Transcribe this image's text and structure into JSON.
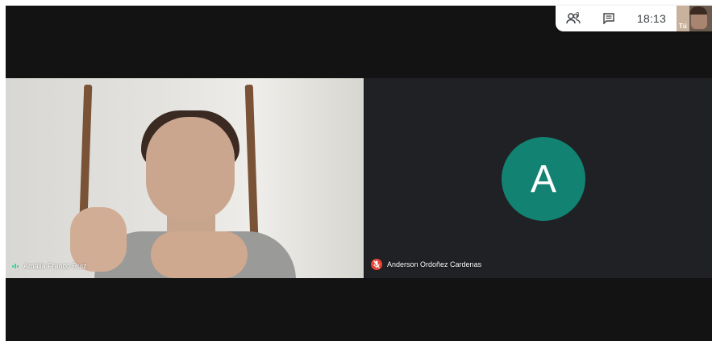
{
  "topbar": {
    "participants_count": "3",
    "time": "18:13",
    "self_label": "Tú"
  },
  "participants": [
    {
      "name": "Amalia Franco Ruiz",
      "mic": "active"
    },
    {
      "name": "Anderson Ordoñez Cardenas",
      "mic": "muted",
      "avatar_letter": "A",
      "avatar_color": "#128273"
    }
  ],
  "colors": {
    "stage_bg": "#131313",
    "tile_bg": "#202124",
    "muted_red": "#ea4335",
    "speaking_green": "#34d399"
  }
}
